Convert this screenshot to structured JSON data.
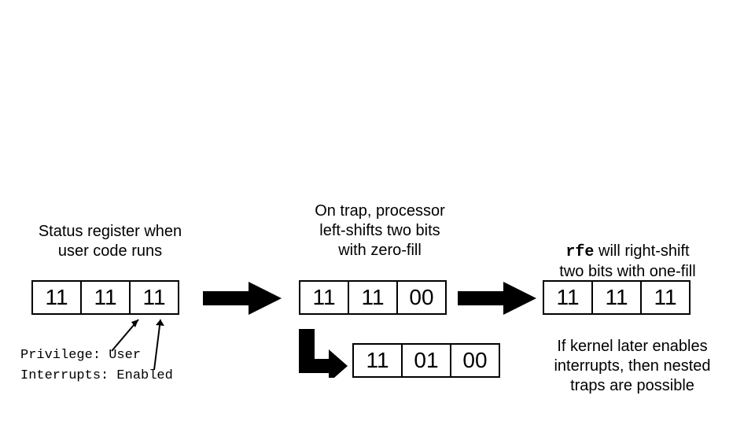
{
  "captions": {
    "left": "Status register when\nuser code runs",
    "middle": "On trap, processor\nleft-shifts two bits\nwith zero-fill",
    "right_prefix": "rfe",
    "right_rest": " will right-shift\ntwo bits with one-fill",
    "bottom_right": "If kernel later enables\ninterrupts, then nested\ntraps are possible"
  },
  "registers": {
    "r1": [
      "11",
      "11",
      "11"
    ],
    "r2": [
      "11",
      "11",
      "00"
    ],
    "r3": [
      "11",
      "11",
      "11"
    ],
    "r4": [
      "11",
      "01",
      "00"
    ]
  },
  "annotations": {
    "privilege": "Privilege: User",
    "interrupts": "Interrupts: Enabled"
  }
}
